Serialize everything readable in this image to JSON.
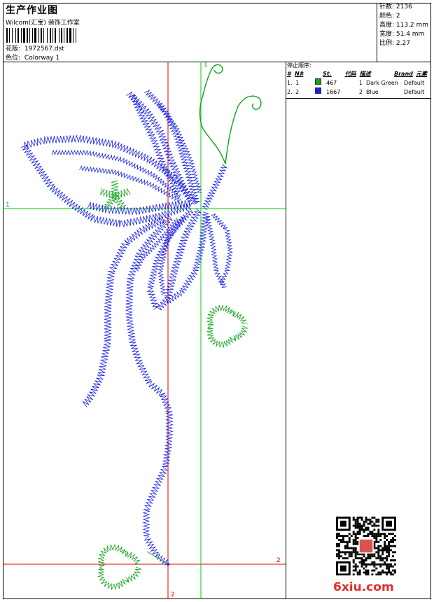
{
  "header": {
    "title": "生产作业图",
    "company": "Wilcom(汇宝) 装饰工作室",
    "design_label": "花版:",
    "design_value": "1972567.dst",
    "colorway_label": "色位:",
    "colorway_value": "Colorway 1"
  },
  "stats": {
    "stitches": "针数: 2136",
    "colors": "颜色: 2",
    "height": "高度: 113.2 mm",
    "width": "宽度: 51.4 mm",
    "scale": "比例: 2.27"
  },
  "stop_sequence": {
    "title": "停止顺序:",
    "headers": [
      "#",
      "N#",
      "St.",
      "代码",
      "描述",
      "Brand",
      "元素"
    ],
    "rows": [
      {
        "num": "1.",
        "n": "1",
        "color": "#11a31a",
        "st": "467",
        "code": "1",
        "desc": "Dark Green",
        "brand": "Default"
      },
      {
        "num": "2.",
        "n": "2",
        "color": "#1620e8",
        "st": "1667",
        "code": "2",
        "desc": "Blue",
        "brand": "Default"
      }
    ]
  },
  "axis_labels": {
    "top_green": "1",
    "left_green": "1",
    "right_red": "2",
    "bottom_red": "2"
  },
  "watermark": {
    "brand": "6xiu.com"
  },
  "colors": {
    "green_thread": "#11a31a",
    "blue_thread": "#1620e8",
    "red_axis": "#e00000",
    "green_axis": "#00cc00"
  }
}
